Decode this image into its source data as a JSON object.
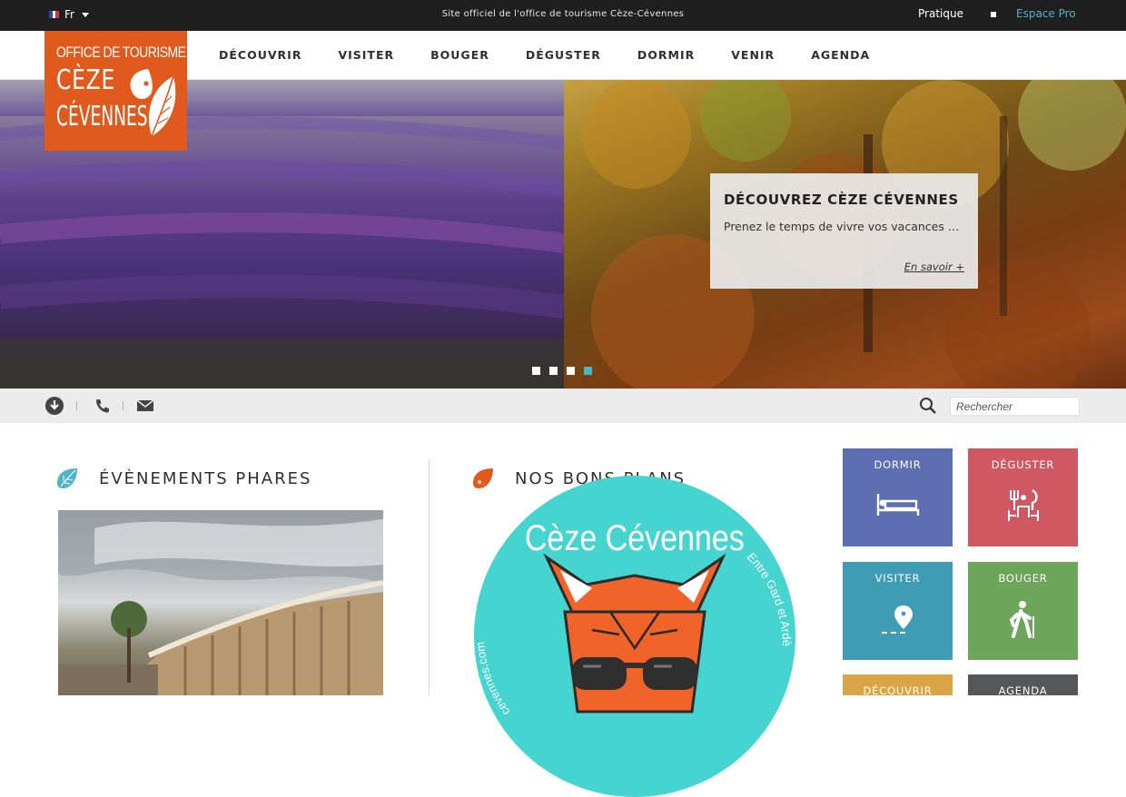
{
  "topbar": {
    "lang": "Fr",
    "tagline": "Site officiel de l'office de tourisme Cèze-Cévennes",
    "pratique": "Pratique",
    "espace_pro": "Espace Pro"
  },
  "logo": {
    "line1": "Office de tourisme",
    "line2": "Cèze",
    "line3": "Cévennes"
  },
  "nav": [
    "DÉCOUVRIR",
    "VISITER",
    "BOUGER",
    "DÉGUSTER",
    "DORMIR",
    "VENIR",
    "AGENDA"
  ],
  "hero": {
    "title": "DÉCOUVREZ CÈZE CÉVENNES",
    "text": "Prenez le temps de vivre vos vacances …",
    "link": "En savoir +",
    "slide_count": 4,
    "active_slide": 4
  },
  "search": {
    "placeholder": "Rechercher"
  },
  "sections": {
    "events_title": "ÉVÈNEMENTS PHARES",
    "plans_title": "NOS BONS PLANS"
  },
  "bons_plans_badge": {
    "title": "Cèze Cévennes",
    "url_text": "cevennes.com",
    "tagline": "Entre Gard et Ardè"
  },
  "tiles": [
    {
      "label": "DORMIR",
      "icon": "bed-icon",
      "color": "#5d6fb1"
    },
    {
      "label": "DÉGUSTER",
      "icon": "dining-icon",
      "color": "#cf5863"
    },
    {
      "label": "VISITER",
      "icon": "map-pin-icon",
      "color": "#3e9cb4"
    },
    {
      "label": "BOUGER",
      "icon": "hiker-icon",
      "color": "#6da55b"
    },
    {
      "label": "DÉCOUVRIR",
      "icon": "",
      "color": "#d9a545"
    },
    {
      "label": "AGENDA",
      "icon": "",
      "color": "#555758"
    }
  ],
  "colors": {
    "brand_orange": "#e05a1d",
    "accent_teal": "#4fb3c8",
    "topbar_bg": "#1f1f1f"
  }
}
